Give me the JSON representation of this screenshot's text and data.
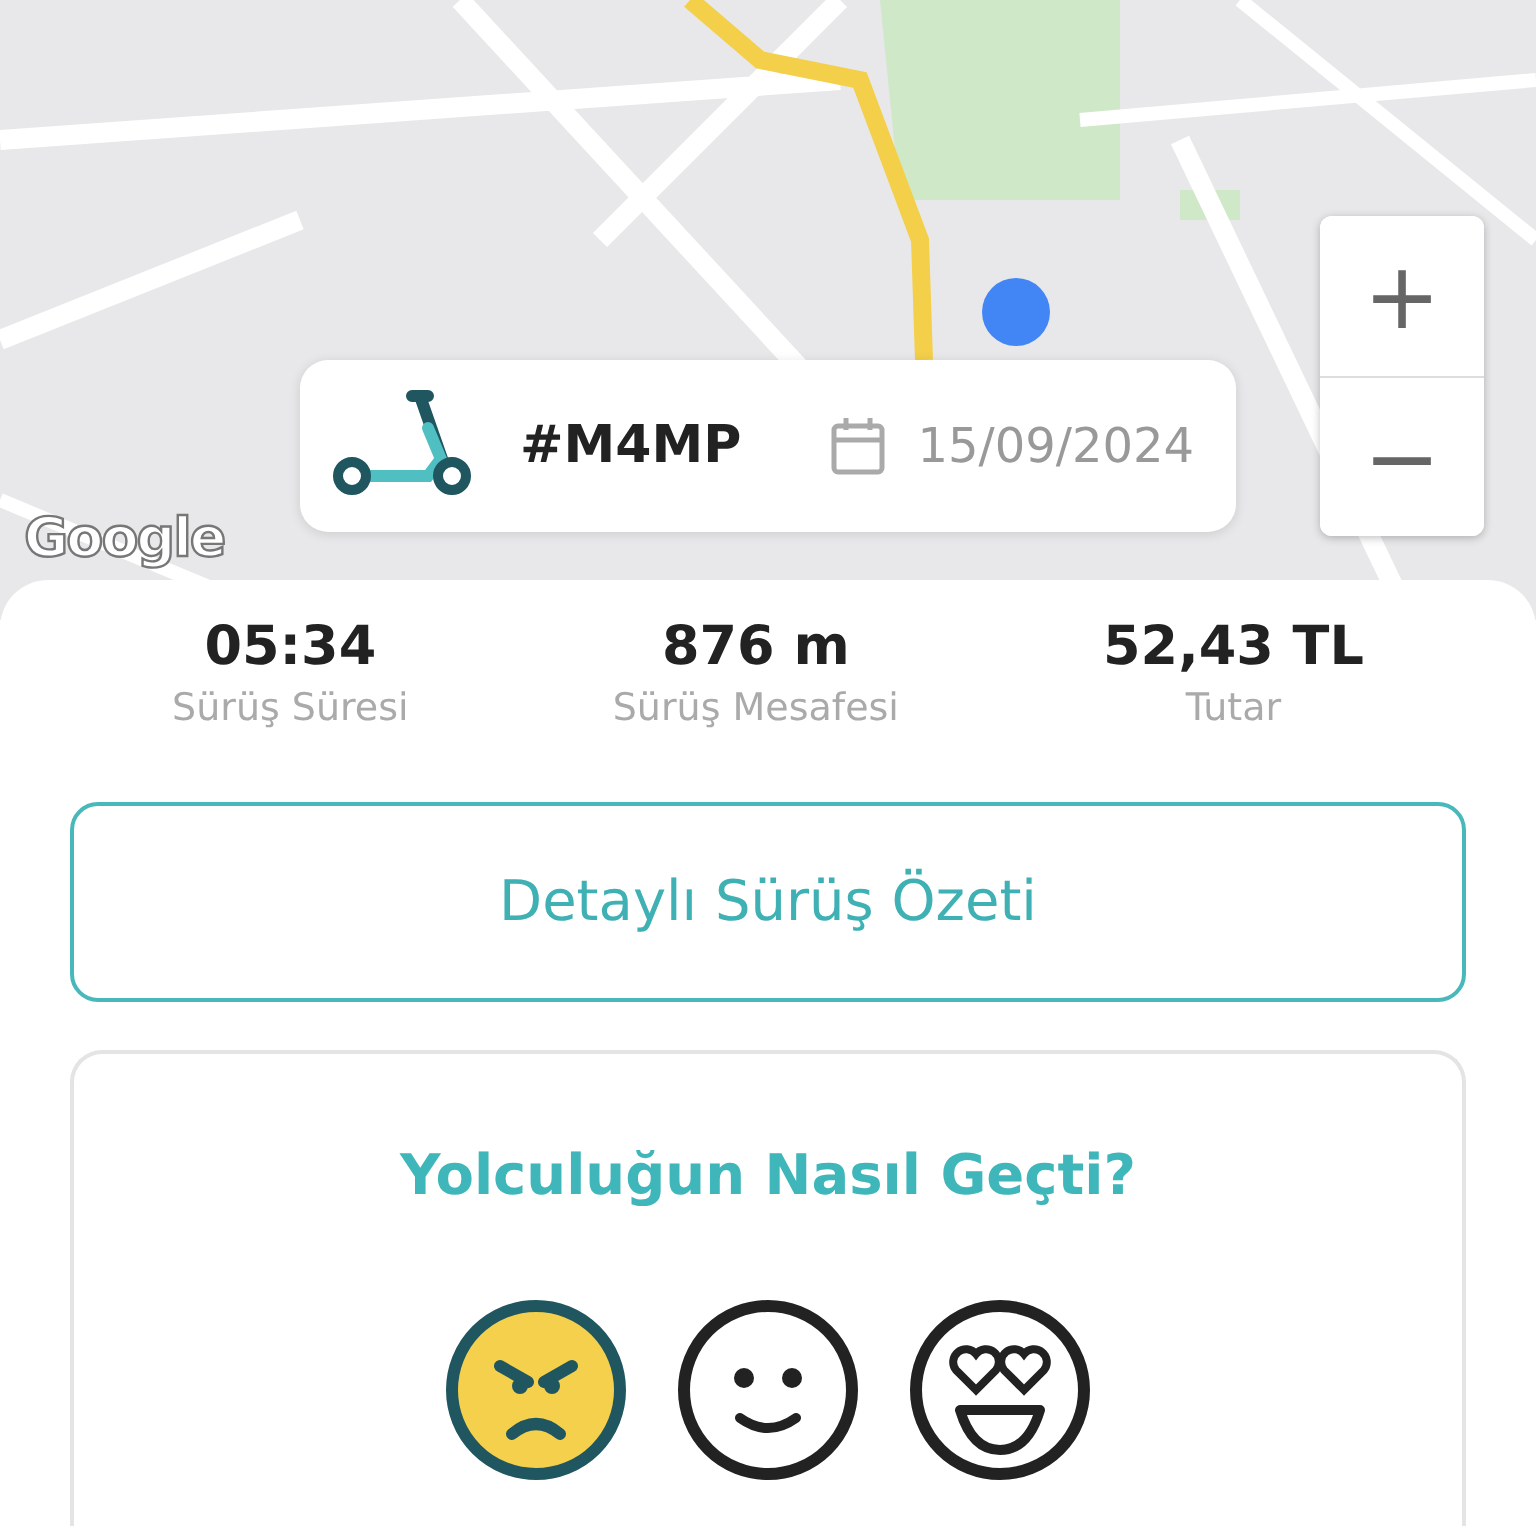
{
  "map": {
    "logo": "Google",
    "zoom_in": "+",
    "zoom_out": "−"
  },
  "ride": {
    "code": "#M4MP",
    "date": "15/09/2024"
  },
  "stats": [
    {
      "value": "05:34",
      "label": "Sürüş Süresi"
    },
    {
      "value": "876 m",
      "label": "Sürüş Mesafesi"
    },
    {
      "value": "52,43 TL",
      "label": "Tutar"
    }
  ],
  "summary_button": "Detaylı Sürüş Özeti",
  "rating": {
    "title": "Yolculuğun Nasıl Geçti?",
    "faces": [
      {
        "kind": "angry",
        "selected": true
      },
      {
        "kind": "neutral",
        "selected": false
      },
      {
        "kind": "love",
        "selected": false
      }
    ]
  }
}
